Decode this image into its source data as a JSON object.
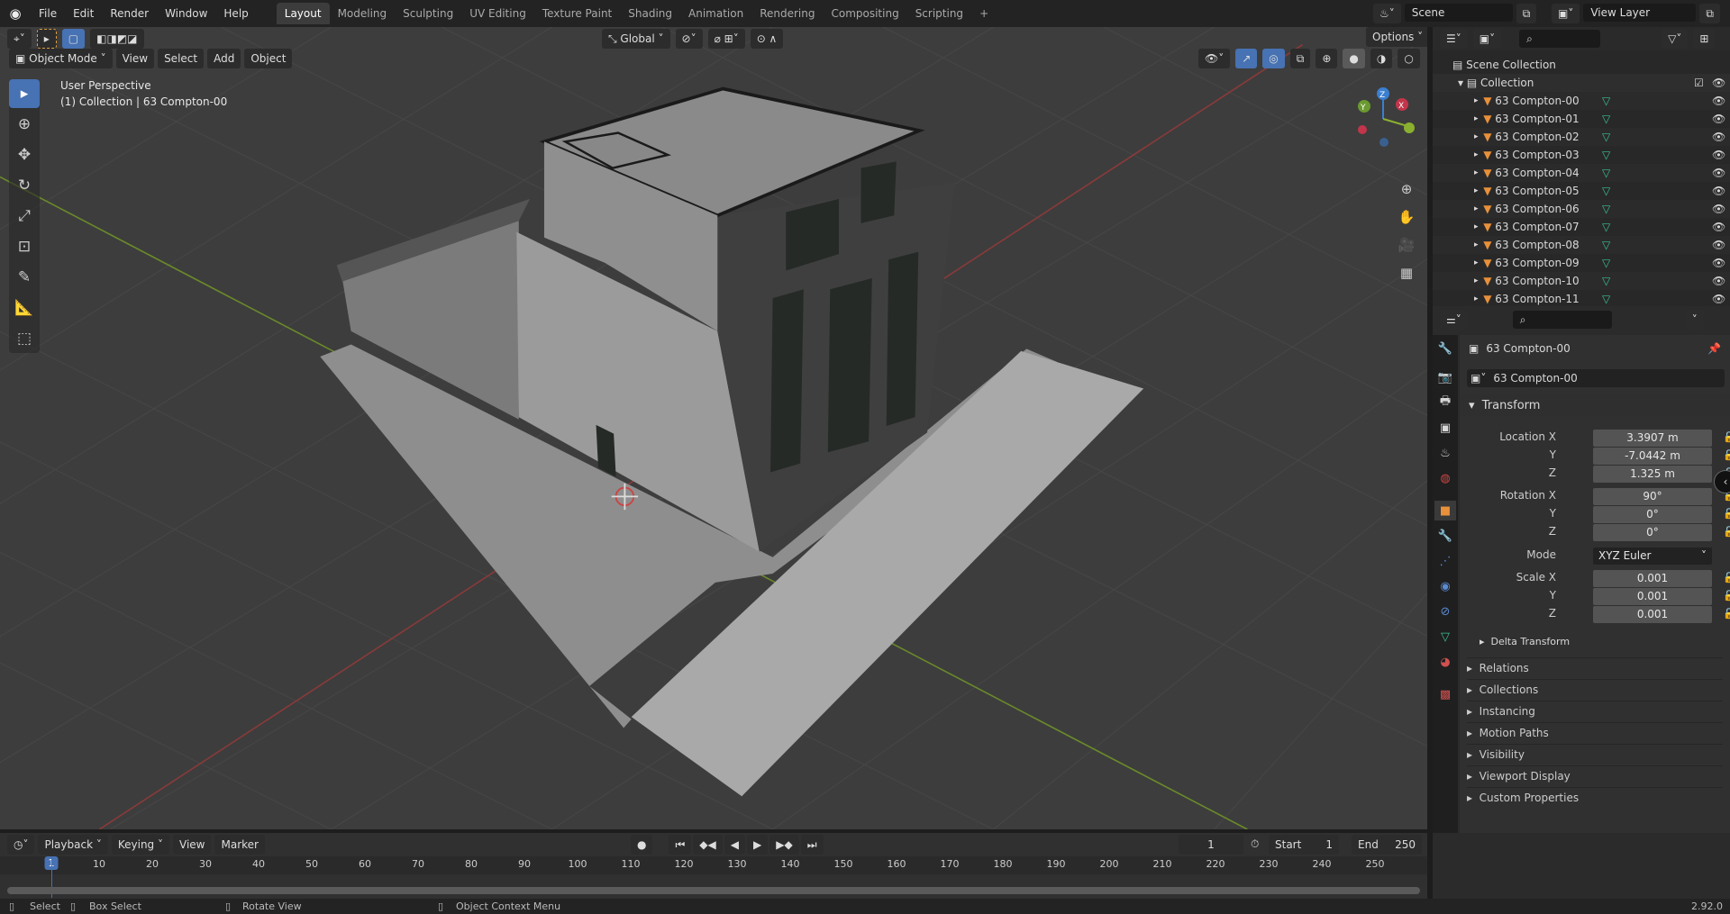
{
  "topbar": {
    "menus": [
      "File",
      "Edit",
      "Render",
      "Window",
      "Help"
    ],
    "workspaces": [
      "Layout",
      "Modeling",
      "Sculpting",
      "UV Editing",
      "Texture Paint",
      "Shading",
      "Animation",
      "Rendering",
      "Compositing",
      "Scripting"
    ],
    "active_workspace": "Layout",
    "add_tab": "+",
    "scene": "Scene",
    "view_layer": "View Layer"
  },
  "viewport": {
    "mode": "Object Mode",
    "menus": [
      "View",
      "Select",
      "Add",
      "Object"
    ],
    "transform_orientation": "Global",
    "options": "Options",
    "perspective": "User Perspective",
    "context": "(1) Collection | 63 Compton-00",
    "gizmo": {
      "x": "X",
      "y": "Y",
      "z": "Z"
    }
  },
  "outliner": {
    "scene_collection": "Scene Collection",
    "collection": "Collection",
    "items": [
      "63 Compton-00",
      "63 Compton-01",
      "63 Compton-02",
      "63 Compton-03",
      "63 Compton-04",
      "63 Compton-05",
      "63 Compton-06",
      "63 Compton-07",
      "63 Compton-08",
      "63 Compton-09",
      "63 Compton-10",
      "63 Compton-11"
    ]
  },
  "properties": {
    "object_name": "63 Compton-00",
    "name_field": "63 Compton-00",
    "transform": {
      "title": "Transform",
      "location_label": "Location X",
      "location": [
        "3.3907 m",
        "-7.0442 m",
        "1.325 m"
      ],
      "rotation_label": "Rotation X",
      "rotation": [
        "90°",
        "0°",
        "0°"
      ],
      "mode_label": "Mode",
      "mode": "XYZ Euler",
      "scale_label": "Scale X",
      "scale": [
        "0.001",
        "0.001",
        "0.001"
      ],
      "axis_y": "Y",
      "axis_z": "Z"
    },
    "delta": "Delta Transform",
    "panels": [
      "Relations",
      "Collections",
      "Instancing",
      "Motion Paths",
      "Visibility",
      "Viewport Display",
      "Custom Properties"
    ],
    "accent": "#4772b3"
  },
  "timeline": {
    "menus": [
      "Playback",
      "Keying",
      "View",
      "Marker"
    ],
    "current_frame": "1",
    "start_label": "Start",
    "start": "1",
    "end_label": "End",
    "end": "250",
    "ticks": [
      "1",
      "10",
      "20",
      "30",
      "40",
      "50",
      "60",
      "70",
      "80",
      "90",
      "100",
      "110",
      "120",
      "130",
      "140",
      "150",
      "160",
      "170",
      "180",
      "190",
      "200",
      "210",
      "220",
      "230",
      "240",
      "250"
    ]
  },
  "status": {
    "select": "Select",
    "box_select": "Box Select",
    "rotate_view": "Rotate View",
    "context_menu": "Object Context Menu",
    "version": "2.92.0"
  }
}
